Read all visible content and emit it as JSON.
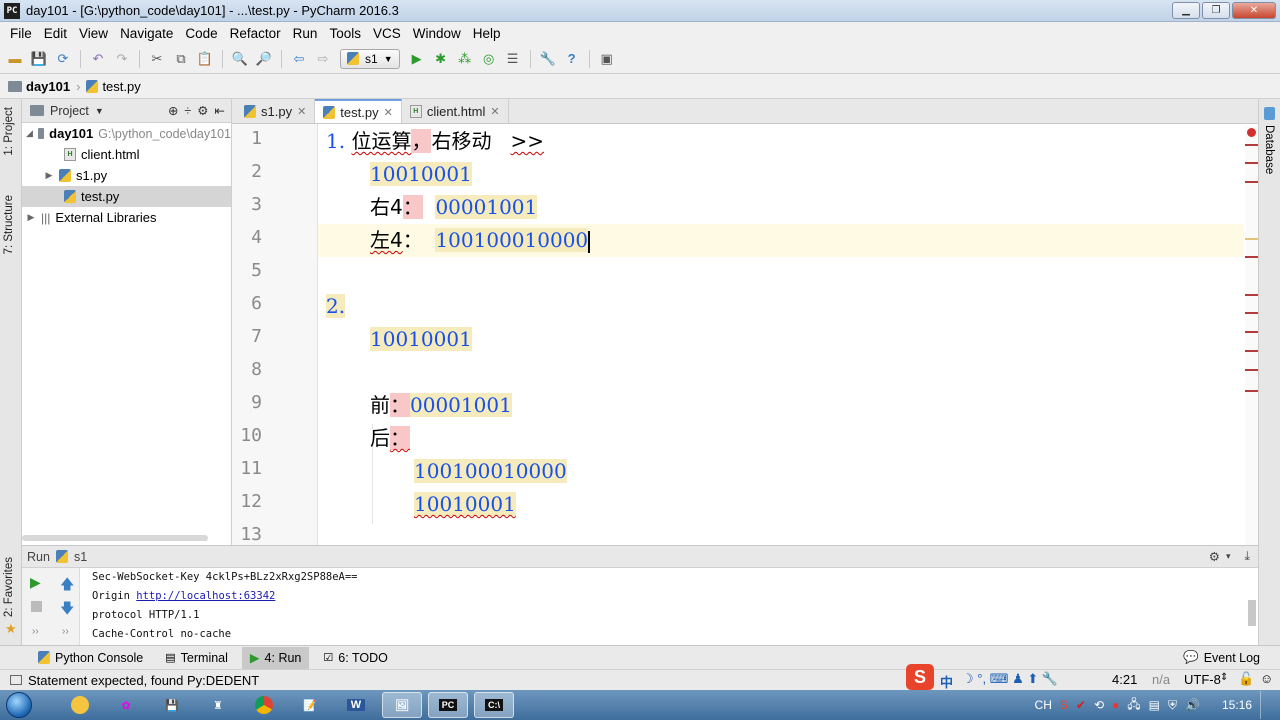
{
  "window": {
    "title": "day101 - [G:\\python_code\\day101] - ...\\test.py - PyCharm 2016.3",
    "app_icon_label": "PC"
  },
  "menu": [
    "File",
    "Edit",
    "View",
    "Navigate",
    "Code",
    "Refactor",
    "Run",
    "Tools",
    "VCS",
    "Window",
    "Help"
  ],
  "toolbar": {
    "run_config": "s1"
  },
  "breadcrumb": {
    "project": "day101",
    "file": "test.py"
  },
  "side_tabs": {
    "project": "1: Project",
    "structure": "7: Structure",
    "favorites": "2: Favorites",
    "database": "Database"
  },
  "project_panel": {
    "header": "Project",
    "root": {
      "name": "day101",
      "path": "G:\\python_code\\day101"
    },
    "items": [
      "client.html",
      "s1.py",
      "test.py"
    ],
    "external": "External Libraries"
  },
  "tabs": [
    "s1.py",
    "test.py",
    "client.html"
  ],
  "code": {
    "line_numbers": [
      "1",
      "2",
      "3",
      "4",
      "5",
      "6",
      "7",
      "8",
      "9",
      "10",
      "11",
      "12",
      "13"
    ],
    "l1_a": "1.",
    "l1_b": "位运算",
    "l1_c": "，",
    "l1_d": "右移动",
    "l1_e": ">>",
    "l2": "10010001",
    "l3_a": "右4",
    "l3_b": "：",
    "l3_c": "00001001",
    "l4_a": "左4",
    "l4_b": "：",
    "l4_c": "100100010000",
    "l6": "2.",
    "l7": "10010001",
    "l9_a": "前",
    "l9_b": "：",
    "l9_c": "00001001",
    "l10_a": "后",
    "l10_b": "：",
    "l11": "100100010000",
    "l12": "10010001"
  },
  "run_panel": {
    "label": "Run",
    "config": "s1",
    "output": {
      "line1": "Sec-WebSocket-Key 4cklPs+BLz2xRxg2SP88eA==",
      "line2_a": "Origin ",
      "line2_link": "http://localhost:63342",
      "line3": "protocol HTTP/1.1",
      "line4": "Cache-Control no-cache"
    }
  },
  "tool_windows": {
    "python_console": "Python Console",
    "terminal": "Terminal",
    "run": "4: Run",
    "todo": "6: TODO",
    "event_log": "Event Log"
  },
  "status": {
    "message": "Statement expected, found Py:DEDENT",
    "position": "4:21",
    "na": "n/a",
    "encoding": "UTF-8"
  },
  "taskbar": {
    "ime": "CH",
    "clock": "15:16",
    "ime_text": "中"
  }
}
